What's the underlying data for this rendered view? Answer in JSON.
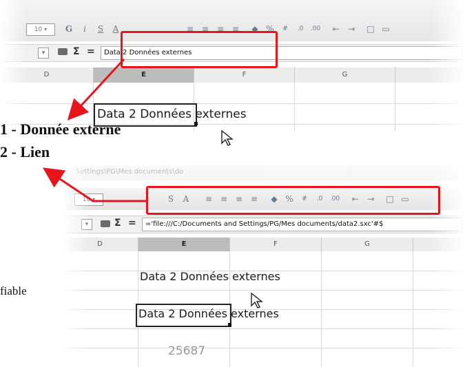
{
  "top_screenshot": {
    "font_size_value": "10",
    "toolbar_glyphs": [
      "G",
      "i",
      "S",
      "A"
    ],
    "name_box_arrow": "▾",
    "sigma": "Σ",
    "equals": "=",
    "formula_content": "Data 2 Données externes",
    "column_headers": [
      "D",
      "E",
      "F",
      "G"
    ],
    "cell_text": "Data 2 Données externes"
  },
  "captions": {
    "line1": "1 - Donnée externe",
    "line2": "2 - Lien"
  },
  "side_text": "fiable",
  "bottom_screenshot": {
    "faded_path": "Settings\\PG\\Mes documents\\do",
    "font_size_value": "10",
    "sigma": "Σ",
    "equals": "=",
    "formula_content": "='file:///C:/Documents and Settings/PG/Mes documents/data2.sxc'#$",
    "column_headers": [
      "D",
      "E",
      "F",
      "G"
    ],
    "cell_text_1": "Data 2 Données externes",
    "cell_text_2": "Data 2 Données externes",
    "cell_value": "25687"
  },
  "colors": {
    "highlight_red": "#e8141b",
    "selected_header": "#bcbcbc"
  },
  "icons": [
    "dropdown-arrow-icon",
    "sigma-icon",
    "mouse-cursor-icon",
    "percent-icon",
    "indent-icon",
    "align-icon"
  ]
}
